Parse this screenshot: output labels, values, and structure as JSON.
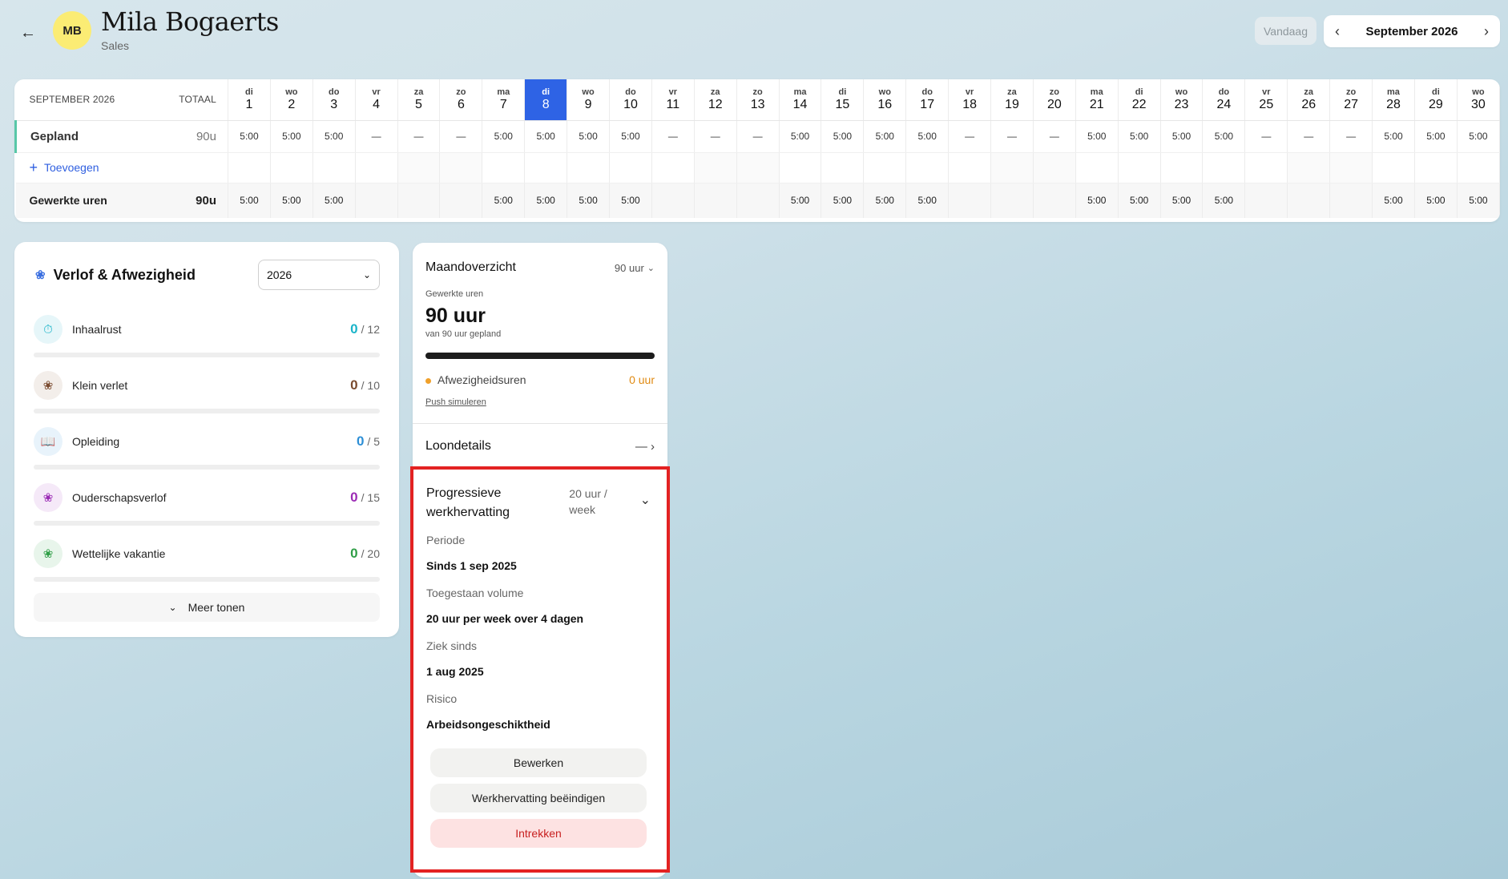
{
  "header": {
    "back_icon": "arrow-left-icon",
    "avatar_initials": "MB",
    "name": "Mila Bogaerts",
    "department": "Sales",
    "today_label": "Vandaag",
    "month_label": "September 2026",
    "prev_icon": "chevron-left-icon",
    "next_icon": "chevron-right-icon"
  },
  "calendar": {
    "month_header": "SEPTEMBER 2026",
    "total_header": "TOTAAL",
    "today_index": 7,
    "days": [
      {
        "abbr": "di",
        "num": "1",
        "planned": "5:00",
        "worked": "5:00"
      },
      {
        "abbr": "wo",
        "num": "2",
        "planned": "5:00",
        "worked": "5:00"
      },
      {
        "abbr": "do",
        "num": "3",
        "planned": "5:00",
        "worked": "5:00"
      },
      {
        "abbr": "vr",
        "num": "4",
        "planned": "—",
        "worked": ""
      },
      {
        "abbr": "za",
        "num": "5",
        "planned": "—",
        "worked": ""
      },
      {
        "abbr": "zo",
        "num": "6",
        "planned": "—",
        "worked": ""
      },
      {
        "abbr": "ma",
        "num": "7",
        "planned": "5:00",
        "worked": "5:00"
      },
      {
        "abbr": "di",
        "num": "8",
        "planned": "5:00",
        "worked": "5:00"
      },
      {
        "abbr": "wo",
        "num": "9",
        "planned": "5:00",
        "worked": "5:00"
      },
      {
        "abbr": "do",
        "num": "10",
        "planned": "5:00",
        "worked": "5:00"
      },
      {
        "abbr": "vr",
        "num": "11",
        "planned": "—",
        "worked": ""
      },
      {
        "abbr": "za",
        "num": "12",
        "planned": "—",
        "worked": ""
      },
      {
        "abbr": "zo",
        "num": "13",
        "planned": "—",
        "worked": ""
      },
      {
        "abbr": "ma",
        "num": "14",
        "planned": "5:00",
        "worked": "5:00"
      },
      {
        "abbr": "di",
        "num": "15",
        "planned": "5:00",
        "worked": "5:00"
      },
      {
        "abbr": "wo",
        "num": "16",
        "planned": "5:00",
        "worked": "5:00"
      },
      {
        "abbr": "do",
        "num": "17",
        "planned": "5:00",
        "worked": "5:00"
      },
      {
        "abbr": "vr",
        "num": "18",
        "planned": "—",
        "worked": ""
      },
      {
        "abbr": "za",
        "num": "19",
        "planned": "—",
        "worked": ""
      },
      {
        "abbr": "zo",
        "num": "20",
        "planned": "—",
        "worked": ""
      },
      {
        "abbr": "ma",
        "num": "21",
        "planned": "5:00",
        "worked": "5:00"
      },
      {
        "abbr": "di",
        "num": "22",
        "planned": "5:00",
        "worked": "5:00"
      },
      {
        "abbr": "wo",
        "num": "23",
        "planned": "5:00",
        "worked": "5:00"
      },
      {
        "abbr": "do",
        "num": "24",
        "planned": "5:00",
        "worked": "5:00"
      },
      {
        "abbr": "vr",
        "num": "25",
        "planned": "—",
        "worked": ""
      },
      {
        "abbr": "za",
        "num": "26",
        "planned": "—",
        "worked": ""
      },
      {
        "abbr": "zo",
        "num": "27",
        "planned": "—",
        "worked": ""
      },
      {
        "abbr": "ma",
        "num": "28",
        "planned": "5:00",
        "worked": "5:00"
      },
      {
        "abbr": "di",
        "num": "29",
        "planned": "5:00",
        "worked": "5:00"
      },
      {
        "abbr": "wo",
        "num": "30",
        "planned": "5:00",
        "worked": "5:00"
      }
    ],
    "planned_label": "Gepland",
    "planned_total": "90u",
    "add_label": "Toevoegen",
    "worked_label": "Gewerkte uren",
    "worked_total": "90u"
  },
  "leave": {
    "title": "Verlof & Afwezigheid",
    "title_icon": "palm-tree-icon",
    "year": "2026",
    "items": [
      {
        "name": "Inhaalrust",
        "count": "0",
        "total": "/ 12",
        "icon": "stopwatch-icon",
        "color": "#1bb4c9",
        "bg": "#e6f6f9"
      },
      {
        "name": "Klein verlet",
        "count": "0",
        "total": "/ 10",
        "icon": "palm-tree-icon",
        "color": "#7a4a2e",
        "bg": "#f3eeea"
      },
      {
        "name": "Opleiding",
        "count": "0",
        "total": "/ 5",
        "icon": "book-icon",
        "color": "#2d8fd6",
        "bg": "#e8f3fb"
      },
      {
        "name": "Ouderschapsverlof",
        "count": "0",
        "total": "/ 15",
        "icon": "palm-tree-icon",
        "color": "#9b2bb5",
        "bg": "#f5e9f8"
      },
      {
        "name": "Wettelijke vakantie",
        "count": "0",
        "total": "/ 20",
        "icon": "palm-tree-icon",
        "color": "#2f9e46",
        "bg": "#e8f5eb"
      }
    ],
    "more_label": "Meer tonen"
  },
  "overview": {
    "title": "Maandoverzicht",
    "total": "90 uur",
    "worked_label": "Gewerkte uren",
    "worked_value": "90 uur",
    "planned_sub": "van 90 uur gepland",
    "progress": 1.0,
    "absence_label": "Afwezigheidsuren",
    "absence_value": "0 uur",
    "push_label": "Push simuleren",
    "salary_label": "Loondetails",
    "salary_value": "—"
  },
  "progressive": {
    "title": "Progressieve werkhervatting",
    "volume": "20 uur / week",
    "period_label": "Periode",
    "period_value": "Sinds 1 sep 2025",
    "allowed_label": "Toegestaan volume",
    "allowed_value": "20 uur per week over 4 dagen",
    "sick_label": "Ziek sinds",
    "sick_value": "1 aug 2025",
    "risk_label": "Risico",
    "risk_value": "Arbeidsongeschiktheid",
    "edit_label": "Bewerken",
    "end_label": "Werkhervatting beëindigen",
    "revoke_label": "Intrekken"
  }
}
